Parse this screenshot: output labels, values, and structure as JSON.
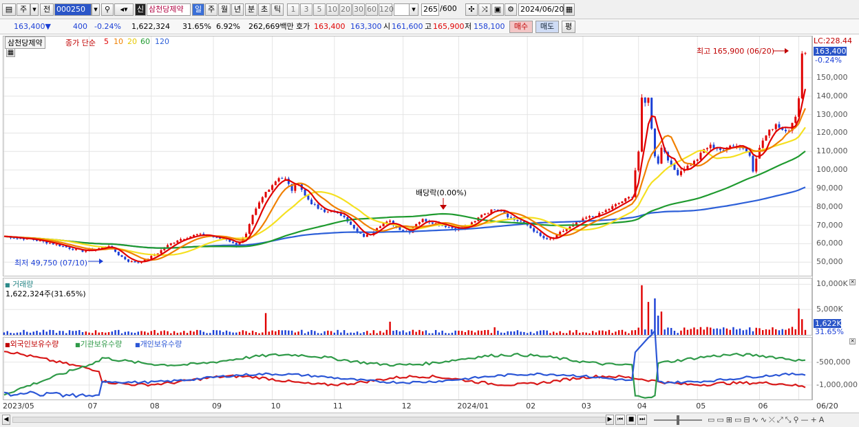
{
  "toolbar": {
    "period_toggle": "주",
    "prev_label": "전",
    "stock_code": "000250",
    "badge_new": "신",
    "stock_name": "삼천당제약",
    "period_tabs": [
      "일",
      "주",
      "월",
      "년",
      "분",
      "초",
      "틱"
    ],
    "range_buttons": [
      "1",
      "3",
      "5",
      "10",
      "20",
      "30",
      "60",
      "120"
    ],
    "count_value": "265",
    "count_max": "/600",
    "date_value": "2024/06/20"
  },
  "quote": {
    "price": "163,400",
    "change": "400",
    "change_pct": "-0.24%",
    "volume": "1,622,324",
    "turnover_pct": "31.65%",
    "pct2": "6.92%",
    "amount": "262,669백만",
    "ask_label": "호가",
    "ask": "163,400",
    "bid": "163,300",
    "open_label": "시",
    "open": "161,600",
    "high_label": "고",
    "high": "165,900",
    "low_label": "저",
    "low": "158,100",
    "buy_label": "매수",
    "sell_label": "매도",
    "avg_label": "평"
  },
  "price_panel": {
    "stock_tab": "삼천당제약",
    "legend_prefix": "종가 단순",
    "ma_labels": [
      "5",
      "10",
      "20",
      "60",
      "120"
    ],
    "max_label": "최고 165,900 (06/20)",
    "min_label": "최저 49,750 (07/10)",
    "dividend_label": "배당락(0.00%)",
    "lc_label": "LC:228.44",
    "last_price_tag": "163,400",
    "last_change_tag": "-0.24%"
  },
  "volume_panel": {
    "title": "거래량",
    "value_label": "1,622,324주(31.65%)",
    "last_tag": "1,622K",
    "last_pct_tag": "31.65%"
  },
  "holding_panel": {
    "series_labels": [
      "외국인보유수량",
      "기관보유수량",
      "개인보유수량"
    ]
  },
  "colors": {
    "up": "#e00000",
    "down": "#1b3fd6",
    "ma5": "#e00000",
    "ma10": "#f08000",
    "ma20": "#f5e020",
    "ma60": "#1e9a2e",
    "ma120": "#2c5fd8",
    "foreign": "#d81818",
    "institution": "#2f9a48",
    "individual": "#2b56d6"
  },
  "chart_data": [
    {
      "type": "line",
      "title": "",
      "series_note": "종가 단순 이동평균 5 10 20 60 120",
      "x": [
        "2023/05",
        "07",
        "08",
        "09",
        "10",
        "11",
        "12",
        "2024/01",
        "02",
        "03",
        "04",
        "05",
        "06",
        "06/20"
      ],
      "ylim": [
        43000,
        172000
      ],
      "yticks": [
        50000,
        60000,
        70000,
        80000,
        90000,
        100000,
        110000,
        120000,
        130000,
        140000,
        150000
      ],
      "close": [
        [
          0,
          64000
        ],
        [
          4,
          63000
        ],
        [
          8,
          62500
        ],
        [
          12,
          61000
        ],
        [
          16,
          59500
        ],
        [
          20,
          57500
        ],
        [
          24,
          56000
        ],
        [
          28,
          57000
        ],
        [
          32,
          59000
        ],
        [
          35,
          54000
        ],
        [
          38,
          50500
        ],
        [
          41,
          49750
        ],
        [
          44,
          52000
        ],
        [
          47,
          55000
        ],
        [
          50,
          59000
        ],
        [
          53,
          62000
        ],
        [
          56,
          63500
        ],
        [
          59,
          65000
        ],
        [
          62,
          64500
        ],
        [
          65,
          63000
        ],
        [
          68,
          62500
        ],
        [
          71,
          59000
        ],
        [
          74,
          65000
        ],
        [
          76,
          75000
        ],
        [
          78,
          82000
        ],
        [
          80,
          88000
        ],
        [
          82,
          92000
        ],
        [
          84,
          96000
        ],
        [
          86,
          95000
        ],
        [
          88,
          89000
        ],
        [
          90,
          93000
        ],
        [
          92,
          86000
        ],
        [
          94,
          82000
        ],
        [
          96,
          79000
        ],
        [
          98,
          77000
        ],
        [
          100,
          78000
        ],
        [
          102,
          76000
        ],
        [
          104,
          75000
        ],
        [
          106,
          70000
        ],
        [
          108,
          66000
        ],
        [
          110,
          64000
        ],
        [
          112,
          65000
        ],
        [
          114,
          69000
        ],
        [
          116,
          71000
        ],
        [
          118,
          72000
        ],
        [
          120,
          69000
        ],
        [
          122,
          67000
        ],
        [
          124,
          66500
        ],
        [
          126,
          71000
        ],
        [
          128,
          73000
        ],
        [
          130,
          72000
        ],
        [
          132,
          71000
        ],
        [
          134,
          70000
        ],
        [
          136,
          69000
        ],
        [
          138,
          68000
        ],
        [
          140,
          68500
        ],
        [
          142,
          70000
        ],
        [
          144,
          72000
        ],
        [
          146,
          76000
        ],
        [
          148,
          77000
        ],
        [
          150,
          79000
        ],
        [
          152,
          78000
        ],
        [
          154,
          75000
        ],
        [
          156,
          73000
        ],
        [
          158,
          72000
        ],
        [
          160,
          70000
        ],
        [
          162,
          67000
        ],
        [
          164,
          64000
        ],
        [
          166,
          62000
        ],
        [
          168,
          63000
        ],
        [
          170,
          66000
        ],
        [
          172,
          68000
        ],
        [
          174,
          70000
        ],
        [
          176,
          72000
        ],
        [
          178,
          74000
        ],
        [
          180,
          75000
        ],
        [
          182,
          76000
        ],
        [
          184,
          78000
        ],
        [
          186,
          80000
        ],
        [
          188,
          82000
        ],
        [
          190,
          84000
        ],
        [
          192,
          86000
        ],
        [
          193,
          100000
        ],
        [
          194,
          110000
        ],
        [
          195,
          138000
        ],
        [
          196,
          136000
        ],
        [
          197,
          140000
        ],
        [
          198,
          122000
        ],
        [
          199,
          108000
        ],
        [
          200,
          104000
        ],
        [
          201,
          112000
        ],
        [
          202,
          110000
        ],
        [
          204,
          102000
        ],
        [
          206,
          98000
        ],
        [
          208,
          101000
        ],
        [
          210,
          103000
        ],
        [
          212,
          106000
        ],
        [
          214,
          111000
        ],
        [
          216,
          113000
        ],
        [
          218,
          112000
        ],
        [
          220,
          110000
        ],
        [
          222,
          114000
        ],
        [
          224,
          113000
        ],
        [
          226,
          112000
        ],
        [
          228,
          108000
        ],
        [
          229,
          100000
        ],
        [
          230,
          107000
        ],
        [
          232,
          116000
        ],
        [
          234,
          121000
        ],
        [
          236,
          125000
        ],
        [
          238,
          122000
        ],
        [
          240,
          122000
        ],
        [
          242,
          128000
        ],
        [
          243,
          140000
        ],
        [
          244,
          163000
        ],
        [
          245,
          163400
        ]
      ]
    },
    {
      "type": "bar",
      "title": "거래량",
      "yticks": [
        5000,
        10000
      ],
      "unit": "K",
      "last_value": 1622
    },
    {
      "type": "line",
      "series": [
        {
          "name": "외국인보유수량"
        },
        {
          "name": "기관보유수량"
        },
        {
          "name": "개인보유수량"
        }
      ],
      "yticks": [
        -500000,
        -1000000
      ]
    }
  ]
}
